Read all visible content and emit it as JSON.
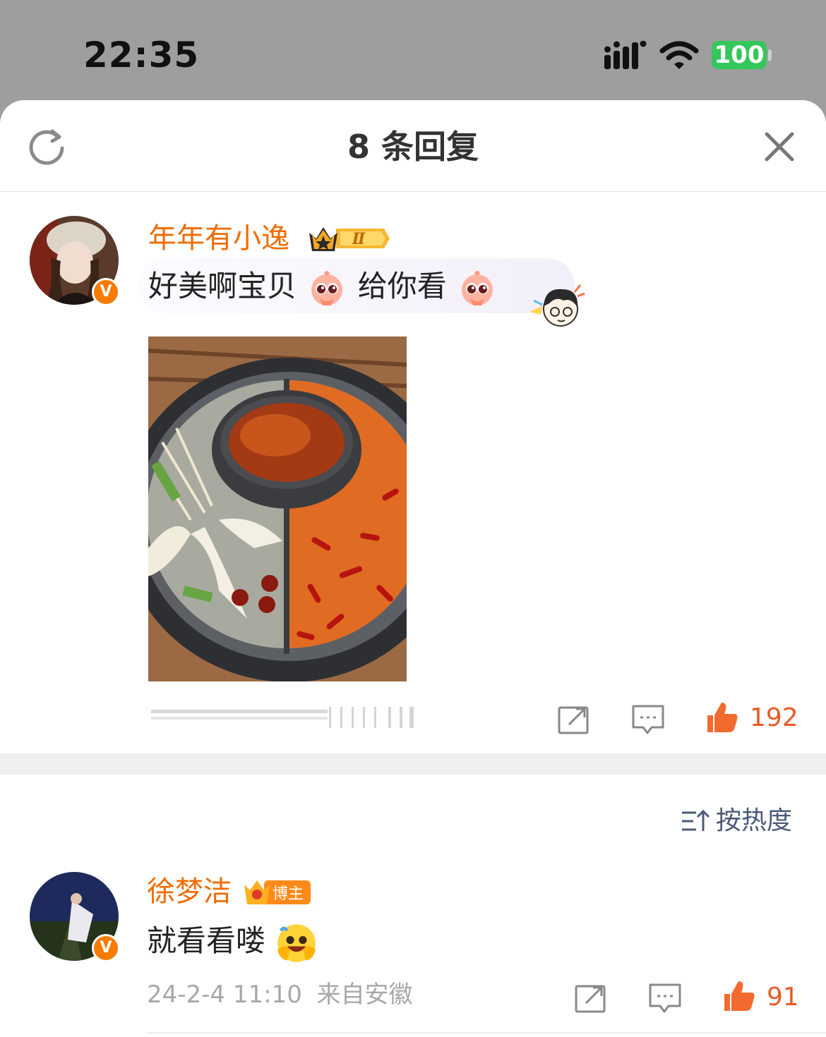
{
  "status_bar": {
    "time": "22:35",
    "battery": "100",
    "icons": [
      "signal-icon",
      "wifi-icon",
      "battery-icon"
    ]
  },
  "sheet": {
    "title": "8 条回复",
    "icons": [
      "refresh-icon",
      "close-icon"
    ]
  },
  "root_comment": {
    "username": "年年有小逸",
    "vip_level": "Ⅱ",
    "text_part1": "好美啊宝贝",
    "text_part2": "给你看",
    "emoji": "peach-emoji",
    "like_count": "192"
  },
  "sort": {
    "label": "按热度"
  },
  "reply": {
    "username": "徐梦洁",
    "badge": "博主",
    "text": "就看看喽",
    "time": "24-2-4 11:10",
    "location": "来自安徽",
    "like_count": "91"
  },
  "colors": {
    "accent": "#ef6c00",
    "like": "#ea5a26",
    "battery": "#34c759",
    "verify": "#f57c00"
  }
}
